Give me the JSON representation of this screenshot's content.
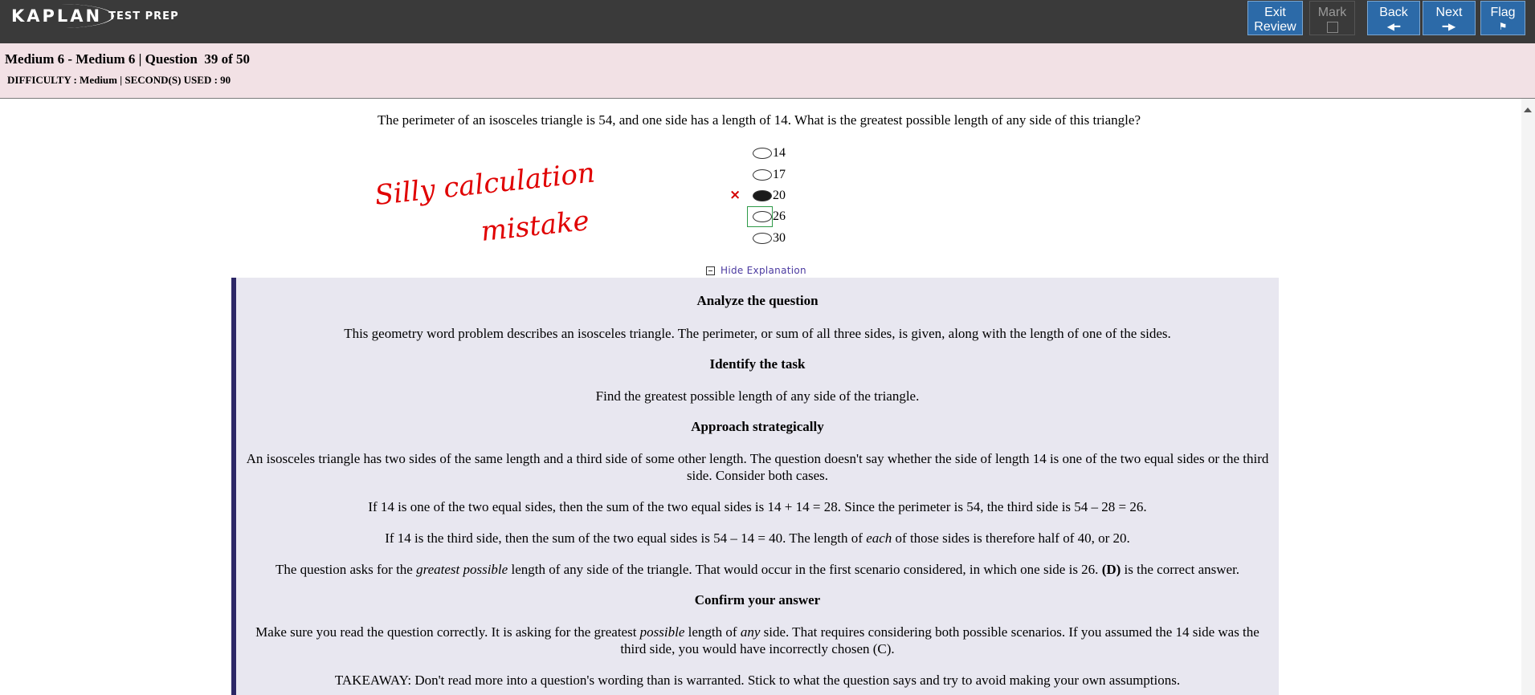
{
  "brand": {
    "logo_main": "KAPLAN",
    "logo_sub": "TEST PREP"
  },
  "nav": {
    "exit_review": [
      "Exit",
      "Review"
    ],
    "mark": "Mark",
    "back": "Back",
    "next": "Next",
    "flag": "Flag"
  },
  "header": {
    "title": "Medium 6 - Medium 6 | Question  39 of 50",
    "meta": "DIFFICULTY : Medium | SECOND(S) USED : 90"
  },
  "question": {
    "text": "The perimeter of an isosceles triangle is 54, and one side has a length of 14. What is the greatest possible length of any side of this triangle?",
    "choices": [
      "14",
      "17",
      "20",
      "26",
      "30"
    ],
    "selected_choice": "20",
    "incorrect_marker": "×",
    "focused_choice": "26"
  },
  "annotation": {
    "line1": "Silly calculation",
    "line2": "mistake",
    "color": "#e00000"
  },
  "explanation": {
    "toggle_label": "Hide Explanation",
    "h1": "Analyze the question",
    "p1": "This geometry word problem describes an isosceles triangle. The perimeter, or sum of all three sides, is given, along with the length of one of the sides.",
    "h2": "Identify the task",
    "p2": "Find the greatest possible length of any side of the triangle.",
    "h3": "Approach strategically",
    "p3": "An isosceles triangle has two sides of the same length and a third side of some other length. The question doesn't say whether the side of length 14 is one of the two equal sides or the third side. Consider both cases.",
    "p4": "If 14 is one of the two equal sides, then the sum of the two equal sides is 14 + 14 = 28. Since the perimeter is 54, the third side is 54 – 28 = 26.",
    "p5_a": "If 14 is the third side, then the sum of the two equal sides is 54 – 14 = 40. The length of ",
    "p5_em": "each",
    "p5_b": " of those sides is therefore half of 40, or 20.",
    "p6_a": "The question asks for the ",
    "p6_em": "greatest possible",
    "p6_b": " length of any side of the triangle. That would occur in the first scenario considered, in which one side is 26. ",
    "p6_strong": "(D)",
    "p6_c": " is the correct answer.",
    "h4": "Confirm your answer",
    "p7_a": "Make sure you read the question correctly. It is asking for the greatest ",
    "p7_em1": "possible",
    "p7_b": " length of ",
    "p7_em2": "any",
    "p7_c": " side. That requires considering both possible scenarios. If you assumed the 14 side was the third side, you would have incorrectly chosen (C).",
    "p8": "TAKEAWAY: Don't read more into a question's wording than is warranted. Stick to what the question says and try to avoid making your own assumptions."
  },
  "colors": {
    "topbar": "#3a3a3a",
    "button": "#2c6aa8",
    "header_band": "#f2e1e5",
    "explanation_bg": "#e8e7f0",
    "explanation_bar": "#2c2766",
    "link": "#4b3aa0",
    "wrong": "#d40000",
    "focus": "#2e9a48"
  }
}
